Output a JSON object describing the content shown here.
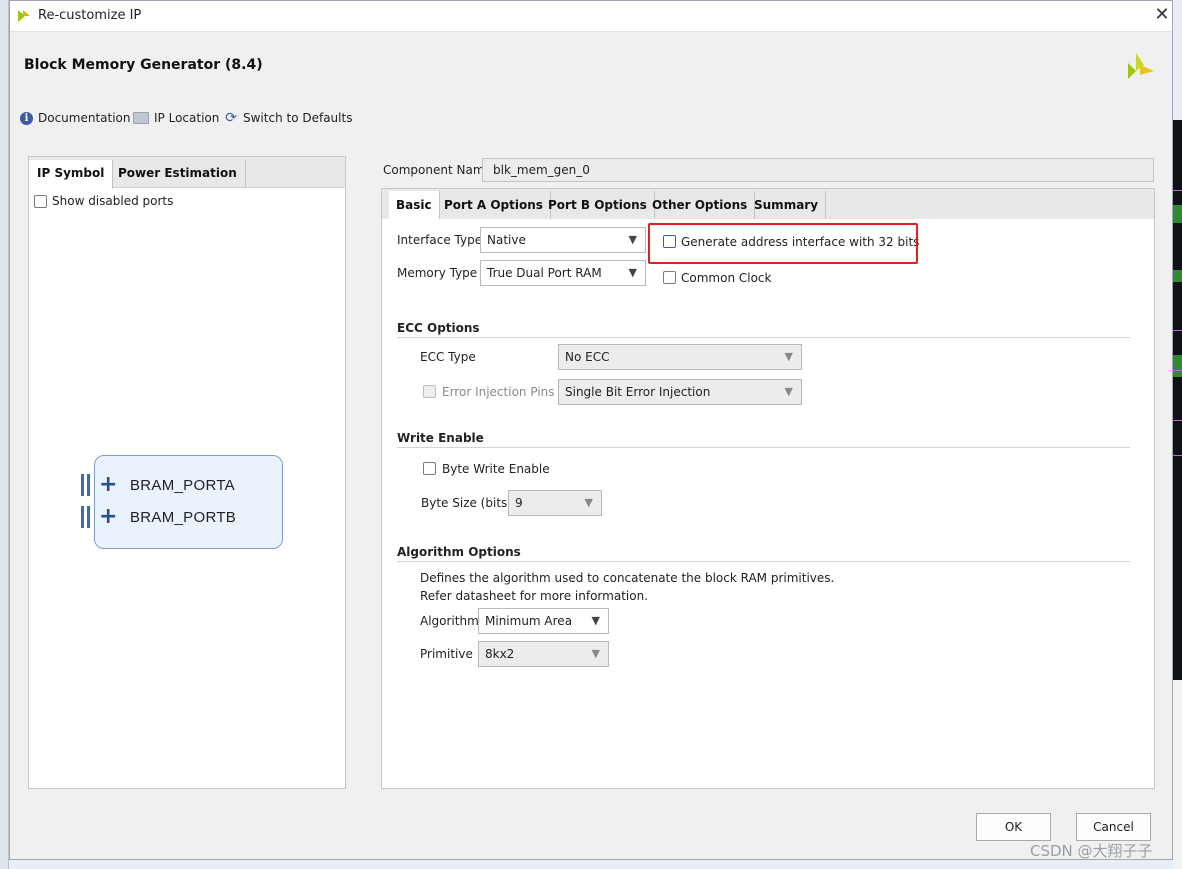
{
  "window": {
    "title": "Re-customize IP",
    "close_glyph": "✕"
  },
  "header": {
    "title": "Block Memory Generator (8.4)"
  },
  "toolbar": {
    "documentation": "Documentation",
    "ip_location": "IP Location",
    "switch_defaults": "Switch to Defaults"
  },
  "left_panel": {
    "tabs": [
      "IP Symbol",
      "Power Estimation"
    ],
    "show_disabled_ports": "Show disabled ports",
    "ports": [
      "BRAM_PORTA",
      "BRAM_PORTB"
    ]
  },
  "component": {
    "label": "Component Name",
    "value": "blk_mem_gen_0"
  },
  "tabs": [
    "Basic",
    "Port A Options",
    "Port B Options",
    "Other Options",
    "Summary"
  ],
  "basic": {
    "interface_type_label": "Interface Type",
    "interface_type_value": "Native",
    "memory_type_label": "Memory Type",
    "memory_type_value": "True Dual Port RAM",
    "gen_addr_32": "Generate address interface with 32 bits",
    "common_clock": "Common Clock",
    "ecc_section": "ECC Options",
    "ecc_type_label": "ECC Type",
    "ecc_type_value": "No ECC",
    "error_injection_label": "Error Injection Pins",
    "error_injection_value": "Single Bit Error Injection",
    "write_enable_section": "Write Enable",
    "byte_write_enable": "Byte Write Enable",
    "byte_size_label": "Byte Size (bits)",
    "byte_size_value": "9",
    "algorithm_section": "Algorithm Options",
    "algo_desc1": "Defines the algorithm used to concatenate the block RAM primitives.",
    "algo_desc2": "Refer datasheet for more information.",
    "algorithm_label": "Algorithm",
    "algorithm_value": "Minimum Area",
    "primitive_label": "Primitive",
    "primitive_value": "8kx2"
  },
  "buttons": {
    "ok": "OK",
    "cancel": "Cancel"
  },
  "watermark": "CSDN @大翔子子",
  "colors": {
    "highlight": "#e41f1f",
    "accent": "#3b5aa7",
    "logo": "#9bc40f"
  }
}
